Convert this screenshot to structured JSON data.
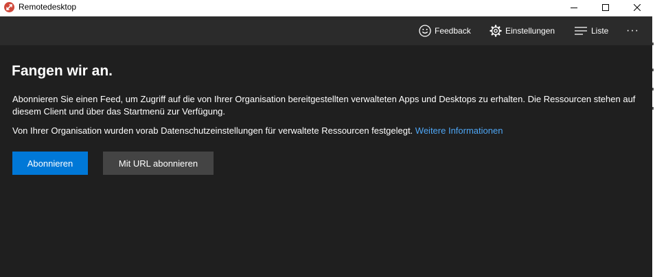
{
  "window": {
    "title": "Remotedesktop"
  },
  "toolbar": {
    "feedback_label": "Feedback",
    "settings_label": "Einstellungen",
    "list_label": "Liste",
    "more_label": "···"
  },
  "main": {
    "heading": "Fangen wir an.",
    "description": "Abonnieren Sie einen Feed, um Zugriff auf die von Ihrer Organisation bereitgestellten verwalteten Apps und Desktops zu erhalten. Die Ressourcen stehen auf diesem Client und über das Startmenü zur Verfügung.",
    "privacy_text": "Von Ihrer Organisation wurden vorab Datenschutzeinstellungen für verwaltete Ressourcen festgelegt.",
    "privacy_link": "Weitere Informationen",
    "subscribe_button": "Abonnieren",
    "subscribe_url_button": "Mit URL abonnieren"
  },
  "colors": {
    "background": "#1f1f1f",
    "toolbar": "#2b2b2b",
    "accent": "#0078d7",
    "link": "#4ea6f5",
    "secondary_button": "#444444",
    "app_icon": "#d0483a"
  }
}
